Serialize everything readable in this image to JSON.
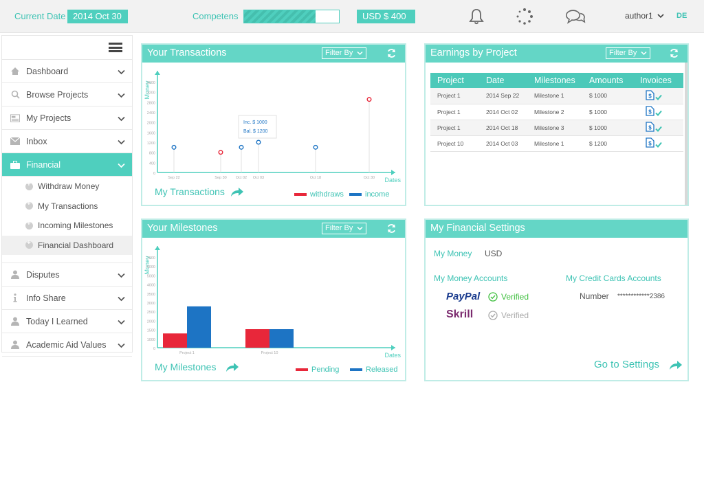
{
  "topbar": {
    "current_date_label": "Current Date",
    "current_date_value": "2014 Oct 30",
    "competens_label": "Competens",
    "competens_progress": 0.75,
    "balance": "USD  $ 400",
    "icons": [
      "bell-icon",
      "loading-icon",
      "chat-icon"
    ],
    "user": "author1",
    "language": "DE"
  },
  "sidebar": {
    "items": [
      {
        "label": "Dashboard",
        "icon": "home-icon"
      },
      {
        "label": "Browse Projects",
        "icon": "search-icon"
      },
      {
        "label": "My Projects",
        "icon": "projects-icon"
      },
      {
        "label": "Inbox",
        "icon": "mail-icon"
      },
      {
        "label": "Financial",
        "icon": "briefcase-icon"
      }
    ],
    "subitems": [
      {
        "label": "Withdraw Money"
      },
      {
        "label": "My Transactions"
      },
      {
        "label": "Incoming Milestones"
      },
      {
        "label": "Financial Dashboard"
      }
    ],
    "items2": [
      {
        "label": "Disputes",
        "icon": "user-icon"
      },
      {
        "label": "Info Share",
        "icon": "info-icon"
      },
      {
        "label": "Today I Learned",
        "icon": "user-icon"
      },
      {
        "label": "Academic Aid Values",
        "icon": "user-icon"
      }
    ]
  },
  "transactions": {
    "title": "Your Transactions",
    "filter": "Filter By",
    "link": "My Transactions",
    "legend_withdraws": "withdraws",
    "legend_income": "income",
    "tooltip_inc": "Inc.  $ 1000",
    "tooltip_bal": "Bal.  $ 1200"
  },
  "milestones": {
    "title": "Your Milestones",
    "filter": "Filter By",
    "link": "My Milestones",
    "legend_pending": "Pending",
    "legend_released": "Released"
  },
  "earnings": {
    "title": "Earnings by Project",
    "filter": "Filter By",
    "headers": [
      "Project",
      "Date",
      "Milestones",
      "Amounts",
      "Invoices"
    ],
    "rows": [
      {
        "project": "Project 1",
        "date": "2014 Sep 22",
        "milestone": "Milestone 1",
        "amount": "$   1000"
      },
      {
        "project": "Project 1",
        "date": "2014 Oct 02",
        "milestone": "Milestone 2",
        "amount": "$   1000"
      },
      {
        "project": "Project 1",
        "date": "2014 Oct 18",
        "milestone": "Milestone 3",
        "amount": "$   1000"
      },
      {
        "project": "Project 10",
        "date": "2014 Oct 03",
        "milestone": "Milestone 1",
        "amount": "$   1200"
      }
    ]
  },
  "settings": {
    "title": "My Financial Settings",
    "my_money_label": "My Money",
    "my_money_value": "USD",
    "accounts_label": "My Money Accounts",
    "cards_label": "My Credit Cards Accounts",
    "paypal_logo": "PayPal",
    "paypal_status": "Verified",
    "skrill_logo": "Skrill",
    "skrill_status": "Verified",
    "number_label": "Number",
    "number_value": "************2386",
    "go_to_settings": "Go to Settings"
  },
  "colors": {
    "accent": "#4fcfbe",
    "red": "#e8273a",
    "blue": "#1d74c4"
  },
  "chart_data": [
    {
      "type": "scatter",
      "ylabel": "Money",
      "xlabel": "Dates",
      "yticks": [
        "0",
        "400",
        "800",
        "1200",
        "1600",
        "2000",
        "2400",
        "2800",
        "3200",
        "3600"
      ],
      "ylim": [
        0,
        3600
      ],
      "xticks": [
        "Sep 22",
        "Sep 30",
        "Oct 02",
        "Oct 03",
        "Oct 18",
        "Oct 30"
      ],
      "series": [
        {
          "name": "withdraws",
          "color": "#e8273a",
          "points": [
            {
              "x": "Sep 30",
              "y": 800
            },
            {
              "x": "Oct 30",
              "y": 2900
            }
          ]
        },
        {
          "name": "income",
          "color": "#1d74c4",
          "points": [
            {
              "x": "Sep 22",
              "y": 1000
            },
            {
              "x": "Oct 02",
              "y": 1000
            },
            {
              "x": "Oct 03",
              "y": 1200
            },
            {
              "x": "Oct 18",
              "y": 1000
            }
          ]
        }
      ]
    },
    {
      "type": "bar",
      "ylabel": "Money",
      "xlabel": "Dates",
      "yticks": [
        "0",
        "1000",
        "1500",
        "2000",
        "2500",
        "3000",
        "3500",
        "4000",
        "5000",
        "6000",
        "7000"
      ],
      "ylim": [
        0,
        7000
      ],
      "categories": [
        "Project 1",
        "Project 10"
      ],
      "series": [
        {
          "name": "Pending",
          "color": "#e8273a",
          "values": [
            1000,
            1300
          ]
        },
        {
          "name": "Released",
          "color": "#1d74c4",
          "values": [
            2900,
            1300
          ]
        }
      ]
    }
  ]
}
